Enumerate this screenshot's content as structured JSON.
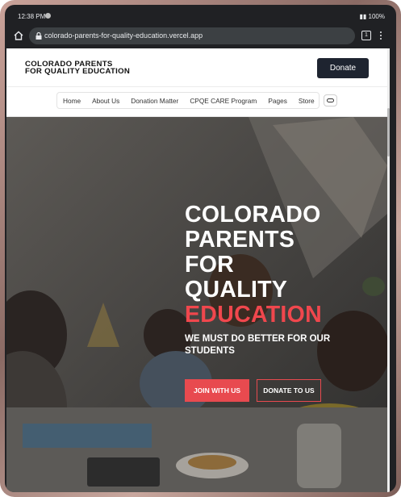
{
  "status_bar": {
    "time": "12:38 PM",
    "battery": "100%"
  },
  "browser": {
    "url": "colorado-parents-for-quality-education.vercel.app",
    "tab_count": "1"
  },
  "header": {
    "logo_line1": "COLORADO PARENTS",
    "logo_line2": "FOR QUALITY EDUCATION",
    "donate_label": "Donate"
  },
  "nav": {
    "items": [
      "Home",
      "About Us",
      "Donation Matter",
      "CPQE CARE Program",
      "Pages",
      "Store"
    ]
  },
  "hero": {
    "title_lines": [
      "COLORADO",
      "PARENTS",
      "FOR",
      "QUALITY"
    ],
    "title_accent": "EDUCATION",
    "subtitle": "WE MUST DO BETTER FOR OUR STUDENTS",
    "join_label": "JOIN WITH US",
    "donate_label": "DONATE TO US"
  },
  "colors": {
    "accent": "#e84a4f",
    "nav_dark": "#1e2430"
  }
}
